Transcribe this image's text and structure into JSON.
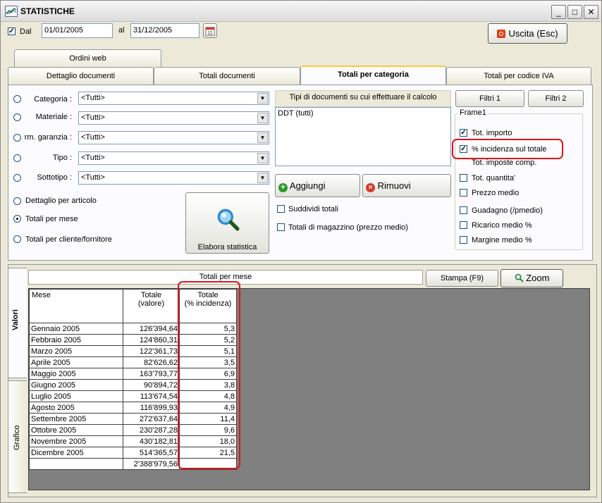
{
  "window": {
    "title": "STATISTICHE",
    "minimize": "_",
    "maximize": "□",
    "close": "✕"
  },
  "dates": {
    "from_label": "Dal",
    "from_value": "01/01/2005",
    "to_label": "al",
    "to_value": "31/12/2005",
    "calendar_day": "12"
  },
  "exit_button": "Uscita (Esc)",
  "tabs": {
    "row1": [
      "Ordini web"
    ],
    "row2": [
      "Dettaglio documenti",
      "Totali documenti",
      "Totali per categoria",
      "Totali per codice IVA"
    ]
  },
  "filters": [
    {
      "label": "Categoria :",
      "value": "<Tutti>"
    },
    {
      "label": "Materiale :",
      "value": "<Tutti>"
    },
    {
      "label": "rm. garanzia :",
      "value": "<Tutti>"
    },
    {
      "label": "Tipo :",
      "value": "<Tutti>"
    },
    {
      "label": "Sottotipo :",
      "value": "<Tutti>"
    }
  ],
  "modes": [
    "Dettaglio per articolo",
    "Totali per mese",
    "Totali per cliente/fornitore"
  ],
  "elabora_button": "Elabora statistica",
  "doc_types": {
    "header": "Tipi di documenti su cui effettuare il calcolo",
    "items": [
      "DDT (tutti)"
    ]
  },
  "add_button": "Aggiungi",
  "remove_button": "Rimuovi",
  "options": {
    "suddividi": "Suddividi totali",
    "magazzino": "Totali di magazzino (prezzo medio)"
  },
  "filter_buttons": [
    "Filtri 1",
    "Filtri 2"
  ],
  "frame": {
    "title": "Frame1",
    "checks": [
      {
        "label": "Tot. importo",
        "checked": true
      },
      {
        "label": "% incidenza sul totale",
        "checked": true
      },
      {
        "label": "Tot. imposte comp.",
        "checked": false
      },
      {
        "label": "Tot. quantita'",
        "checked": false
      },
      {
        "label": "Prezzo medio",
        "checked": false
      },
      {
        "label": "Guadagno (/pmedio)",
        "checked": false
      },
      {
        "label": "Ricarico medio %",
        "checked": false
      },
      {
        "label": "Margine medio %",
        "checked": false
      }
    ]
  },
  "results": {
    "title": "Totali per mese",
    "print_button": "Stampa (F9)",
    "zoom_button": "Zoom",
    "side_tabs": [
      "Valori",
      "Grafico"
    ],
    "columns": [
      "Mese",
      "Totale\n(valore)",
      "Totale\n(% incidenza)"
    ],
    "rows": [
      [
        "Gennaio 2005",
        "126'394,64",
        "5,3"
      ],
      [
        "Febbraio 2005",
        "124'860,31",
        "5,2"
      ],
      [
        "Marzo 2005",
        "122'361,73",
        "5,1"
      ],
      [
        "Aprile 2005",
        "82'626,62",
        "3,5"
      ],
      [
        "Maggio 2005",
        "163'793,77",
        "6,9"
      ],
      [
        "Giugno 2005",
        "90'894,72",
        "3,8"
      ],
      [
        "Luglio 2005",
        "113'674,54",
        "4,8"
      ],
      [
        "Agosto 2005",
        "116'899,93",
        "4,9"
      ],
      [
        "Settembre 2005",
        "272'637,64",
        "11,4"
      ],
      [
        "Ottobre 2005",
        "230'287,28",
        "9,6"
      ],
      [
        "Novembre 2005",
        "430'182,81",
        "18,0"
      ],
      [
        "Dicembre 2005",
        "514'365,57",
        "21,5"
      ]
    ],
    "total": [
      "",
      "2'388'979,56",
      ""
    ]
  }
}
